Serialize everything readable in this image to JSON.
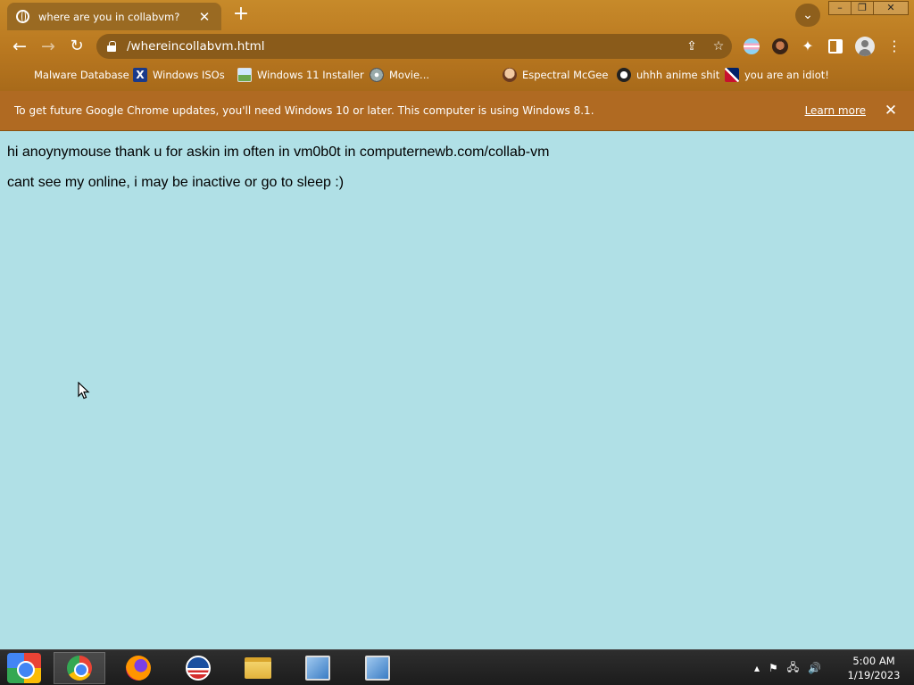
{
  "browser": {
    "tab": {
      "title": "where are you in collabvm?",
      "favicon": "globe-icon"
    },
    "new_tab_label": "+",
    "address_bar": {
      "url": "/whereincollabvm.html"
    },
    "bookmarks": [
      {
        "label": "Malware Database",
        "icon": "none"
      },
      {
        "label": "Windows ISOs",
        "icon": "x-logo-icon"
      },
      {
        "label": "Windows 11 Installer",
        "icon": "image-icon"
      },
      {
        "label": "Movie...",
        "icon": "disc-icon"
      },
      {
        "label": "Espectral McGee",
        "icon": "face-icon"
      },
      {
        "label": "uhhh anime shit",
        "icon": "anime-icon"
      },
      {
        "label": "you are an idiot!",
        "icon": "uk-flag-icon"
      }
    ],
    "infobar": {
      "message": "To get future Google Chrome updates, you'll need Windows 10 or later. This computer is using Windows 8.1.",
      "link": "Learn more"
    }
  },
  "page": {
    "line1": "hi anoynymouse thank u for askin im often in vm0b0t in computernewb.com/collab-vm",
    "line2": "cant see my online, i may be inactive or go to sleep :)",
    "background_color": "#b0e0e6"
  },
  "taskbar": {
    "clock_time": "5:00 AM",
    "clock_date": "1/19/2023",
    "apps": [
      "start-icon",
      "chrome-icon",
      "firefox-icon",
      "obama-logo-icon",
      "file-explorer-icon",
      "setup-icon",
      "setup-icon"
    ]
  },
  "colors": {
    "chrome_theme": "#b97820",
    "infobar": "#b06a22",
    "page_bg": "#b0e0e6"
  }
}
